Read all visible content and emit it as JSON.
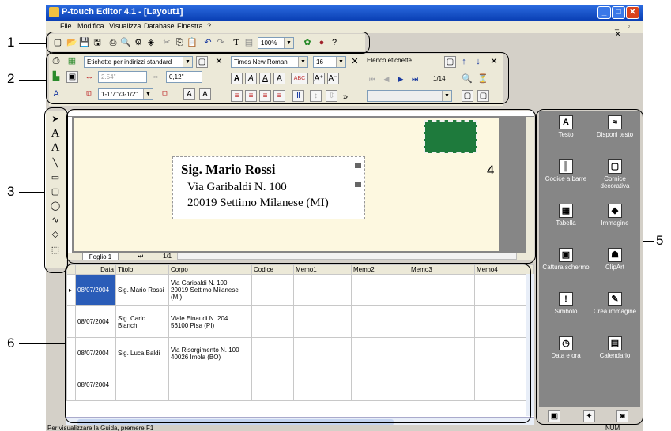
{
  "app": {
    "title": "P-touch Editor 4.1 - [Layout1]"
  },
  "menu": [
    "File",
    "Modifica",
    "Visualizza",
    "Database",
    "Finestra",
    "?"
  ],
  "toolbar": {
    "zoom": "100%"
  },
  "props": {
    "label_type": "Etichette per indirizzi standard",
    "width_value": "2.54\"",
    "margin_value": "0,12\"",
    "size_value": "1-1/7\"x3-1/2\"",
    "font_name": "Times New Roman",
    "font_size": "16",
    "list_title": "Elenco etichette",
    "page_count": "1/14"
  },
  "label": {
    "name": "Sig. Mario Rossi",
    "street": "Via Garibaldi N. 100",
    "city": "20019 Settimo Milanese (MI)"
  },
  "sheet": {
    "tab": "Foglio 1",
    "page": "1/1"
  },
  "db": {
    "headers": [
      "Data",
      "Titolo",
      "Corpo",
      "Codice",
      "Memo1",
      "Memo2",
      "Memo3",
      "Memo4"
    ],
    "rows": [
      {
        "data": "08/07/2004",
        "titolo": "Sig. Mario Rossi",
        "corpo1": "Via Garibaldi N. 100",
        "corpo2": "20019 Settimo Milanese (MI)"
      },
      {
        "data": "08/07/2004",
        "titolo": "Sig. Carlo Bianchi",
        "corpo1": "Viale Einaudi N. 204",
        "corpo2": "56100 Pisa (PI)"
      },
      {
        "data": "08/07/2004",
        "titolo": "Sig. Luca Baldi",
        "corpo1": "Via Risorgimento N. 100",
        "corpo2": "40026 Imola (BO)"
      },
      {
        "data": "08/07/2004",
        "titolo": "",
        "corpo1": "",
        "corpo2": ""
      }
    ]
  },
  "panel": {
    "items": [
      {
        "label": "Testo",
        "icon": "text-icon"
      },
      {
        "label": "Disponi testo",
        "icon": "arrange-text-icon"
      },
      {
        "label": "Codice a barre",
        "icon": "barcode-icon"
      },
      {
        "label": "Cornice decorativa",
        "icon": "frame-icon"
      },
      {
        "label": "Tabella",
        "icon": "table-icon"
      },
      {
        "label": "Immagine",
        "icon": "image-icon"
      },
      {
        "label": "Cattura schermo",
        "icon": "screen-capture-icon"
      },
      {
        "label": "ClipArt",
        "icon": "clipart-icon"
      },
      {
        "label": "Simbolo",
        "icon": "symbol-icon"
      },
      {
        "label": "Crea immagine",
        "icon": "create-image-icon"
      },
      {
        "label": "Data e ora",
        "icon": "clock-icon"
      },
      {
        "label": "Calendario",
        "icon": "calendar-icon"
      }
    ]
  },
  "status": {
    "text": "Per visualizzare la Guida, premere F1",
    "num": "NUM"
  },
  "callouts": [
    "1",
    "2",
    "3",
    "4",
    "5",
    "6"
  ],
  "colors": {
    "title_blue": "#0a3fb4",
    "label_bg": "#fdf8e0",
    "panel_bg": "#868686",
    "stamp": "#1e7a3c"
  }
}
